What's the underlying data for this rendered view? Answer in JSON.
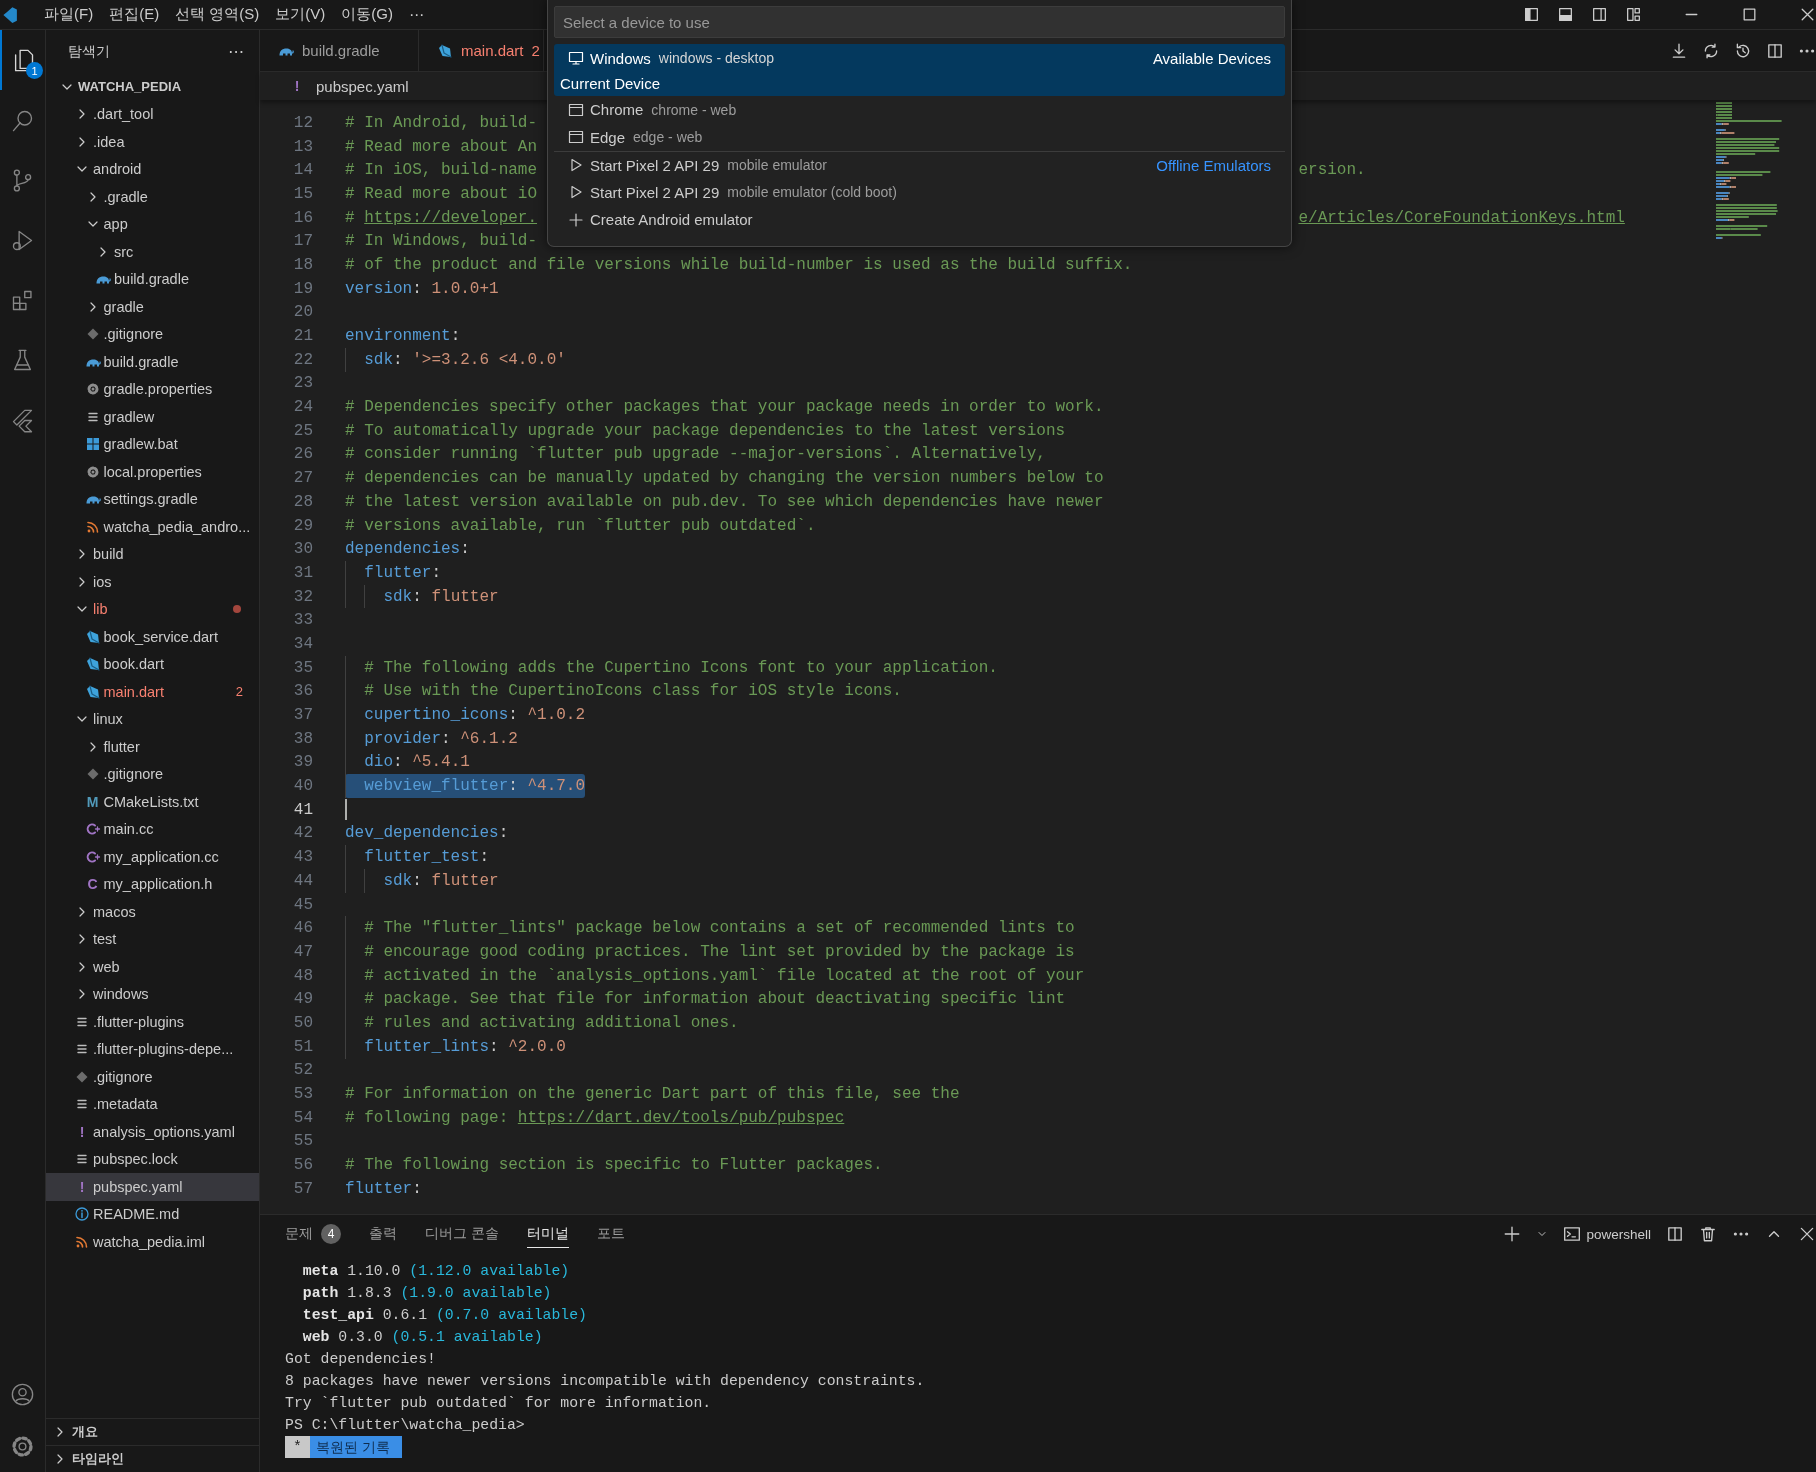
{
  "title_bar": {
    "menu": [
      "파일(F)",
      "편집(E)",
      "선택 영역(S)",
      "보기(V)",
      "이동(G)",
      "⋯"
    ],
    "controls": [
      {
        "kind": "layout-left"
      },
      {
        "kind": "layout-bottom"
      },
      {
        "kind": "layout-right"
      },
      {
        "kind": "layout-custom"
      },
      {
        "kind": "minimize"
      },
      {
        "kind": "maximize"
      },
      {
        "kind": "close"
      }
    ]
  },
  "activity_bar": {
    "items": [
      {
        "kind": "files",
        "selected": true,
        "badge": "1"
      },
      {
        "kind": "search",
        "selected": false
      },
      {
        "kind": "source-control",
        "selected": false
      },
      {
        "kind": "debug",
        "selected": false
      },
      {
        "kind": "extensions",
        "selected": false
      },
      {
        "kind": "testing",
        "selected": false
      },
      {
        "kind": "flutter",
        "selected": false
      }
    ],
    "bottom": [
      {
        "kind": "account"
      },
      {
        "kind": "settings"
      }
    ]
  },
  "sidebar": {
    "title": "탐색기",
    "more": "⋯",
    "root": {
      "label": "WATCHA_PEDIA",
      "expanded": true,
      "children": [
        {
          "label": ".dart_tool",
          "kind": "folder",
          "expanded": false,
          "selected": false,
          "error": false
        },
        {
          "label": ".idea",
          "kind": "folder",
          "expanded": false,
          "selected": false,
          "error": false
        },
        {
          "label": "android",
          "kind": "folder",
          "expanded": true,
          "selected": false,
          "error": false,
          "children": [
            {
              "label": ".gradle",
              "kind": "folder",
              "expanded": false,
              "selected": false,
              "error": false
            },
            {
              "label": "app",
              "kind": "folder",
              "expanded": true,
              "selected": false,
              "error": false,
              "children": [
                {
                  "label": "src",
                  "kind": "folder",
                  "expanded": false,
                  "selected": false,
                  "error": false
                },
                {
                  "label": "build.gradle",
                  "kind": "gradle",
                  "selected": false,
                  "error": false
                }
              ]
            },
            {
              "label": "gradle",
              "kind": "folder",
              "expanded": false,
              "selected": false,
              "error": false
            },
            {
              "label": ".gitignore",
              "kind": "git",
              "selected": false,
              "error": false
            },
            {
              "label": "build.gradle",
              "kind": "gradle",
              "selected": false,
              "error": false
            },
            {
              "label": "gradle.properties",
              "kind": "gear",
              "selected": false,
              "error": false
            },
            {
              "label": "gradlew",
              "kind": "lines",
              "selected": false,
              "error": false
            },
            {
              "label": "gradlew.bat",
              "kind": "windows",
              "selected": false,
              "error": false
            },
            {
              "label": "local.properties",
              "kind": "gear",
              "selected": false,
              "error": false
            },
            {
              "label": "settings.gradle",
              "kind": "gradle",
              "selected": false,
              "error": false
            },
            {
              "label": "watcha_pedia_andro...",
              "kind": "rss",
              "selected": false,
              "error": false
            }
          ]
        },
        {
          "label": "build",
          "kind": "folder",
          "expanded": false,
          "selected": false,
          "error": false
        },
        {
          "label": "ios",
          "kind": "folder",
          "expanded": false,
          "selected": false,
          "error": false
        },
        {
          "label": "lib",
          "kind": "folder",
          "expanded": true,
          "selected": false,
          "error": true,
          "dot": true,
          "children": [
            {
              "label": "book_service.dart",
              "kind": "dart",
              "selected": false,
              "error": false
            },
            {
              "label": "book.dart",
              "kind": "dart",
              "selected": false,
              "error": false
            },
            {
              "label": "main.dart",
              "kind": "dart",
              "selected": false,
              "error": true,
              "badge": "2"
            }
          ]
        },
        {
          "label": "linux",
          "kind": "folder",
          "expanded": true,
          "selected": false,
          "error": false,
          "children": [
            {
              "label": "flutter",
              "kind": "folder",
              "expanded": false,
              "selected": false,
              "error": false
            },
            {
              "label": ".gitignore",
              "kind": "git",
              "selected": false,
              "error": false
            },
            {
              "label": "CMakeLists.txt",
              "kind": "cmake",
              "glyph": "M",
              "selected": false,
              "error": false
            },
            {
              "label": "main.cc",
              "kind": "cpp",
              "selected": false,
              "error": false
            },
            {
              "label": "my_application.cc",
              "kind": "cpp",
              "selected": false,
              "error": false
            },
            {
              "label": "my_application.h",
              "kind": "header",
              "glyph": "C",
              "selected": false,
              "error": false
            }
          ]
        },
        {
          "label": "macos",
          "kind": "folder",
          "expanded": false,
          "selected": false,
          "error": false
        },
        {
          "label": "test",
          "kind": "folder",
          "expanded": false,
          "selected": false,
          "error": false
        },
        {
          "label": "web",
          "kind": "folder",
          "expanded": false,
          "selected": false,
          "error": false
        },
        {
          "label": "windows",
          "kind": "folder",
          "expanded": false,
          "selected": false,
          "error": false
        },
        {
          "label": ".flutter-plugins",
          "kind": "lines",
          "selected": false,
          "error": false
        },
        {
          "label": ".flutter-plugins-depe...",
          "kind": "lines",
          "selected": false,
          "error": false
        },
        {
          "label": ".gitignore",
          "kind": "git",
          "selected": false,
          "error": false
        },
        {
          "label": ".metadata",
          "kind": "lines",
          "selected": false,
          "error": false
        },
        {
          "label": "analysis_options.yaml",
          "kind": "yaml",
          "glyph": "!",
          "selected": false,
          "error": false
        },
        {
          "label": "pubspec.lock",
          "kind": "lines",
          "selected": false,
          "error": false
        },
        {
          "label": "pubspec.yaml",
          "kind": "yaml",
          "glyph": "!",
          "selected": true,
          "error": false
        },
        {
          "label": "README.md",
          "kind": "info",
          "selected": false,
          "error": false
        },
        {
          "label": "watcha_pedia.iml",
          "kind": "rss",
          "selected": false,
          "error": false
        }
      ]
    },
    "sections": [
      {
        "label": "개요",
        "expanded": false
      },
      {
        "label": "타임라인",
        "expanded": false
      }
    ]
  },
  "editor": {
    "tabs": [
      {
        "label": "build.gradle",
        "kind": "gradle",
        "selected": false,
        "error": false
      },
      {
        "label": "main.dart",
        "kind": "dart",
        "selected": false,
        "error": true,
        "badge": "2"
      }
    ],
    "actions": [
      {
        "kind": "download"
      },
      {
        "kind": "sync"
      },
      {
        "kind": "history"
      },
      {
        "kind": "split"
      },
      {
        "kind": "more"
      }
    ],
    "breadcrumb": {
      "glyph": "!",
      "label": "pubspec.yaml"
    },
    "lines": [
      {
        "number": "12",
        "selected": false,
        "tokens": [
          {
            "kind": "c",
            "text": "# In Android, build-"
          }
        ]
      },
      {
        "number": "13",
        "selected": false,
        "tokens": [
          {
            "kind": "c",
            "text": "# Read more about An"
          }
        ]
      },
      {
        "number": "14",
        "selected": false,
        "tokens": [
          {
            "kind": "c",
            "text": "# In iOS, build-name"
          }
        ],
        "tail": [
          {
            "kind": "c",
            "text": "ersion."
          }
        ]
      },
      {
        "number": "15",
        "selected": false,
        "tokens": [
          {
            "kind": "c",
            "text": "# Read more about iO"
          }
        ]
      },
      {
        "number": "16",
        "selected": false,
        "tokens": [
          {
            "kind": "c",
            "text": "# "
          },
          {
            "kind": "u",
            "text": "https://developer."
          }
        ],
        "tail": [
          {
            "kind": "u",
            "text": "e/Articles/CoreFoundationKeys.html"
          }
        ]
      },
      {
        "number": "17",
        "selected": false,
        "tokens": [
          {
            "kind": "c",
            "text": "# In Windows, build-"
          }
        ]
      },
      {
        "number": "18",
        "selected": false,
        "tokens": [
          {
            "kind": "c",
            "text": "# of the product and file versions while build-number is used as the build suffix."
          }
        ]
      },
      {
        "number": "19",
        "selected": false,
        "tokens": [
          {
            "kind": "k",
            "text": "version"
          },
          {
            "kind": "p",
            "text": ": "
          },
          {
            "kind": "v",
            "text": "1.0.0+1"
          }
        ]
      },
      {
        "number": "20"
      },
      {
        "number": "21",
        "selected": false,
        "tokens": [
          {
            "kind": "k",
            "text": "environment"
          },
          {
            "kind": "p",
            "text": ":"
          }
        ]
      },
      {
        "number": "22",
        "selected": false,
        "tokens": [
          {
            "kind": "k",
            "text": "  sdk"
          },
          {
            "kind": "p",
            "text": ": "
          },
          {
            "kind": "v",
            "text": "'>=3.2.6 <4.0.0'"
          }
        ]
      },
      {
        "number": "23"
      },
      {
        "number": "24",
        "selected": false,
        "tokens": [
          {
            "kind": "c",
            "text": "# Dependencies specify other packages that your package needs in order to work."
          }
        ]
      },
      {
        "number": "25",
        "selected": false,
        "tokens": [
          {
            "kind": "c",
            "text": "# To automatically upgrade your package dependencies to the latest versions"
          }
        ]
      },
      {
        "number": "26",
        "selected": false,
        "tokens": [
          {
            "kind": "c",
            "text": "# consider running `flutter pub upgrade --major-versions`. Alternatively,"
          }
        ]
      },
      {
        "number": "27",
        "selected": false,
        "tokens": [
          {
            "kind": "c",
            "text": "# dependencies can be manually updated by changing the version numbers below to"
          }
        ]
      },
      {
        "number": "28",
        "selected": false,
        "tokens": [
          {
            "kind": "c",
            "text": "# the latest version available on pub.dev. To see which dependencies have newer"
          }
        ]
      },
      {
        "number": "29",
        "selected": false,
        "tokens": [
          {
            "kind": "c",
            "text": "# versions available, run `flutter pub outdated`."
          }
        ]
      },
      {
        "number": "30",
        "selected": false,
        "tokens": [
          {
            "kind": "k",
            "text": "dependencies"
          },
          {
            "kind": "p",
            "text": ":"
          }
        ]
      },
      {
        "number": "31",
        "selected": false,
        "tokens": [
          {
            "kind": "k",
            "text": "  flutter"
          },
          {
            "kind": "p",
            "text": ":"
          }
        ]
      },
      {
        "number": "32",
        "selected": false,
        "tokens": [
          {
            "kind": "k",
            "text": "    sdk"
          },
          {
            "kind": "p",
            "text": ": "
          },
          {
            "kind": "v",
            "text": "flutter"
          }
        ]
      },
      {
        "number": "33"
      },
      {
        "number": "34"
      },
      {
        "number": "35",
        "selected": false,
        "tokens": [
          {
            "kind": "c",
            "text": "  # The following adds the Cupertino Icons font to your application."
          }
        ]
      },
      {
        "number": "36",
        "selected": false,
        "tokens": [
          {
            "kind": "c",
            "text": "  # Use with the CupertinoIcons class for iOS style icons."
          }
        ]
      },
      {
        "number": "37",
        "selected": false,
        "tokens": [
          {
            "kind": "k",
            "text": "  cupertino_icons"
          },
          {
            "kind": "p",
            "text": ": "
          },
          {
            "kind": "v",
            "text": "^1.0.2"
          }
        ]
      },
      {
        "number": "38",
        "selected": false,
        "tokens": [
          {
            "kind": "k",
            "text": "  provider"
          },
          {
            "kind": "p",
            "text": ": "
          },
          {
            "kind": "v",
            "text": "^6.1.2"
          }
        ]
      },
      {
        "number": "39",
        "selected": false,
        "tokens": [
          {
            "kind": "k",
            "text": "  dio"
          },
          {
            "kind": "p",
            "text": ": "
          },
          {
            "kind": "v",
            "text": "^5.4.1"
          }
        ]
      },
      {
        "number": "40",
        "selected": true,
        "tokens": [
          {
            "kind": "k",
            "text": "  webview_flutter"
          },
          {
            "kind": "p",
            "text": ": "
          },
          {
            "kind": "v",
            "text": "^4.7.0"
          }
        ]
      },
      {
        "number": "41",
        "current": true
      },
      {
        "number": "42",
        "selected": false,
        "tokens": [
          {
            "kind": "k",
            "text": "dev_dependencies"
          },
          {
            "kind": "p",
            "text": ":"
          }
        ]
      },
      {
        "number": "43",
        "selected": false,
        "tokens": [
          {
            "kind": "k",
            "text": "  flutter_test"
          },
          {
            "kind": "p",
            "text": ":"
          }
        ]
      },
      {
        "number": "44",
        "selected": false,
        "tokens": [
          {
            "kind": "k",
            "text": "    sdk"
          },
          {
            "kind": "p",
            "text": ": "
          },
          {
            "kind": "v",
            "text": "flutter"
          }
        ]
      },
      {
        "number": "45"
      },
      {
        "number": "46",
        "selected": false,
        "tokens": [
          {
            "kind": "c",
            "text": "  # The \"flutter_lints\" package below contains a set of recommended lints to"
          }
        ]
      },
      {
        "number": "47",
        "selected": false,
        "tokens": [
          {
            "kind": "c",
            "text": "  # encourage good coding practices. The lint set provided by the package is"
          }
        ]
      },
      {
        "number": "48",
        "selected": false,
        "tokens": [
          {
            "kind": "c",
            "text": "  # activated in the `analysis_options.yaml` file located at the root of your"
          }
        ]
      },
      {
        "number": "49",
        "selected": false,
        "tokens": [
          {
            "kind": "c",
            "text": "  # package. See that file for information about deactivating specific lint"
          }
        ]
      },
      {
        "number": "50",
        "selected": false,
        "tokens": [
          {
            "kind": "c",
            "text": "  # rules and activating additional ones."
          }
        ]
      },
      {
        "number": "51",
        "selected": false,
        "tokens": [
          {
            "kind": "k",
            "text": "  flutter_lints"
          },
          {
            "kind": "p",
            "text": ": "
          },
          {
            "kind": "v",
            "text": "^2.0.0"
          }
        ]
      },
      {
        "number": "52"
      },
      {
        "number": "53",
        "selected": false,
        "tokens": [
          {
            "kind": "c",
            "text": "# For information on the generic Dart part of this file, see the"
          }
        ]
      },
      {
        "number": "54",
        "selected": false,
        "tokens": [
          {
            "kind": "c",
            "text": "# following page: "
          },
          {
            "kind": "u",
            "text": "https://dart.dev/tools/pub/pubspec"
          }
        ]
      },
      {
        "number": "55"
      },
      {
        "number": "56",
        "selected": false,
        "tokens": [
          {
            "kind": "c",
            "text": "# The following section is specific to Flutter packages."
          }
        ]
      },
      {
        "number": "57",
        "selected": false,
        "tokens": [
          {
            "kind": "k",
            "text": "flutter"
          },
          {
            "kind": "p",
            "text": ":"
          }
        ]
      }
    ]
  },
  "quick_pick": {
    "placeholder": "Select a device to use",
    "items": [
      {
        "kind": "device",
        "label": "Windows",
        "description": "windows - desktop",
        "detail": "Current Device",
        "group": "Available Devices",
        "selected": true
      },
      {
        "kind": "browser",
        "label": "Chrome",
        "description": "chrome - web",
        "selected": false
      },
      {
        "kind": "browser",
        "label": "Edge",
        "description": "edge - web",
        "selected": false
      },
      {
        "kind": "emulator",
        "label": "Start Pixel 2 API 29",
        "description": "mobile emulator",
        "group": "Offline Emulators",
        "selected": false
      },
      {
        "kind": "emulator",
        "label": "Start Pixel 2 API 29",
        "description": "mobile emulator (cold boot)",
        "selected": false
      },
      {
        "kind": "create",
        "label": "Create Android emulator",
        "selected": false
      }
    ]
  },
  "panel": {
    "tabs": [
      {
        "label": "문제",
        "badge": "4",
        "selected": false
      },
      {
        "label": "출력",
        "selected": false
      },
      {
        "label": "디버그 콘솔",
        "selected": false
      },
      {
        "label": "터미널",
        "selected": true
      },
      {
        "label": "포트",
        "selected": false
      }
    ],
    "actions": [
      {
        "kind": "plus"
      },
      {
        "kind": "chevron-down"
      },
      {
        "kind": "shell",
        "label": "powershell"
      },
      {
        "kind": "split"
      },
      {
        "kind": "trash"
      },
      {
        "kind": "more"
      },
      {
        "kind": "chevron-up"
      },
      {
        "kind": "close"
      }
    ],
    "terminal": [
      {
        "tokens": [
          {
            "kind": "b",
            "text": "  meta"
          },
          {
            "kind": "t",
            "text": " 1.10.0 "
          },
          {
            "kind": "i",
            "text": "(1.12.0 available)"
          }
        ]
      },
      {
        "tokens": [
          {
            "kind": "b",
            "text": "  path"
          },
          {
            "kind": "t",
            "text": " 1.8.3 "
          },
          {
            "kind": "i",
            "text": "(1.9.0 available)"
          }
        ]
      },
      {
        "tokens": [
          {
            "kind": "b",
            "text": "  test_api"
          },
          {
            "kind": "t",
            "text": " 0.6.1 "
          },
          {
            "kind": "i",
            "text": "(0.7.0 available)"
          }
        ]
      },
      {
        "tokens": [
          {
            "kind": "b",
            "text": "  web"
          },
          {
            "kind": "t",
            "text": " 0.3.0 "
          },
          {
            "kind": "i",
            "text": "(0.5.1 available)"
          }
        ]
      },
      {
        "tokens": [
          {
            "kind": "t",
            "text": "Got dependencies!"
          }
        ]
      },
      {
        "tokens": [
          {
            "kind": "t",
            "text": "8 packages have newer versions incompatible with dependency constraints."
          }
        ]
      },
      {
        "tokens": [
          {
            "kind": "t",
            "text": "Try `flutter pub outdated` for more information."
          }
        ]
      },
      {
        "tokens": [
          {
            "kind": "t",
            "text": "PS C:\\flutter\\watcha_pedia>"
          }
        ]
      }
    ],
    "restored": {
      "marker": "*",
      "label": "복원된 기록"
    }
  }
}
